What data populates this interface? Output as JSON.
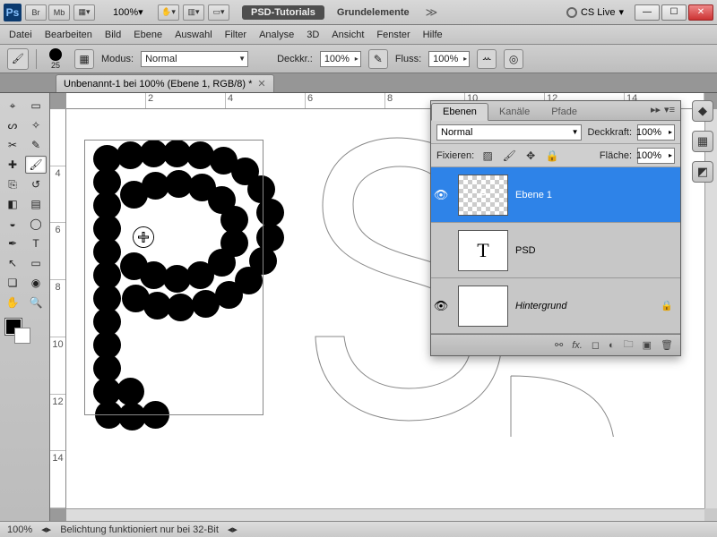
{
  "title": {
    "psd_tutorials": "PSD-Tutorials",
    "doc_set": "Grundelemente",
    "cslive": "CS Live",
    "zoom": "100%"
  },
  "menu": {
    "datei": "Datei",
    "bearbeiten": "Bearbeiten",
    "bild": "Bild",
    "ebene": "Ebene",
    "auswahl": "Auswahl",
    "filter": "Filter",
    "analyse": "Analyse",
    "dreid": "3D",
    "ansicht": "Ansicht",
    "fenster": "Fenster",
    "hilfe": "Hilfe"
  },
  "options": {
    "brush_size": "25",
    "modus_label": "Modus:",
    "modus_value": "Normal",
    "deck_label": "Deckkr.:",
    "deck_value": "100%",
    "fluss_label": "Fluss:",
    "fluss_value": "100%"
  },
  "doc_tab": "Unbenannt-1 bei 100% (Ebene 1, RGB/8) *",
  "panel": {
    "tabs": {
      "ebenen": "Ebenen",
      "kanaele": "Kanäle",
      "pfade": "Pfade"
    },
    "blend": "Normal",
    "deck_label": "Deckkraft:",
    "deck_value": "100%",
    "fix_label": "Fixieren:",
    "flaeche_label": "Fläche:",
    "flaeche_value": "100%",
    "layers": {
      "l1": "Ebene 1",
      "l2": "PSD",
      "l3": "Hintergrund"
    }
  },
  "status": {
    "zoom": "100%",
    "msg": "Belichtung funktioniert nur bei 32-Bit"
  }
}
